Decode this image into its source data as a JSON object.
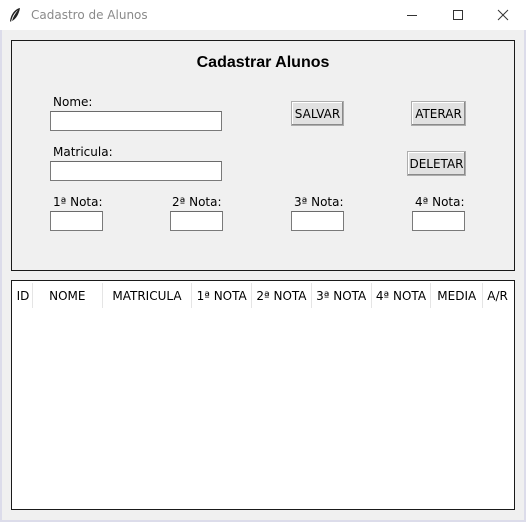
{
  "window": {
    "title": "Cadastro de Alunos",
    "minimize_icon": "minimize-icon",
    "maximize_icon": "maximize-icon",
    "close_icon": "close-icon",
    "app_icon": "feather-icon"
  },
  "form": {
    "heading": "Cadastrar Alunos",
    "nome_label": "Nome:",
    "nome_value": "",
    "matricula_label": "Matricula:",
    "matricula_value": "",
    "nota1_label": "1ª Nota:",
    "nota2_label": "2ª Nota:",
    "nota3_label": "3ª Nota:",
    "nota4_label": "4ª Nota:",
    "nota1_value": "",
    "nota2_value": "",
    "nota3_value": "",
    "nota4_value": "",
    "salvar_label": "SALVAR",
    "aterar_label": "ATERAR",
    "deletar_label": "DELETAR"
  },
  "table": {
    "columns": [
      "ID",
      "NOME",
      "MATRICULA",
      "1ª NOTA",
      "2ª NOTA",
      "3ª NOTA",
      "4ª NOTA",
      "MEDIA",
      "A/R"
    ],
    "rows": []
  }
}
